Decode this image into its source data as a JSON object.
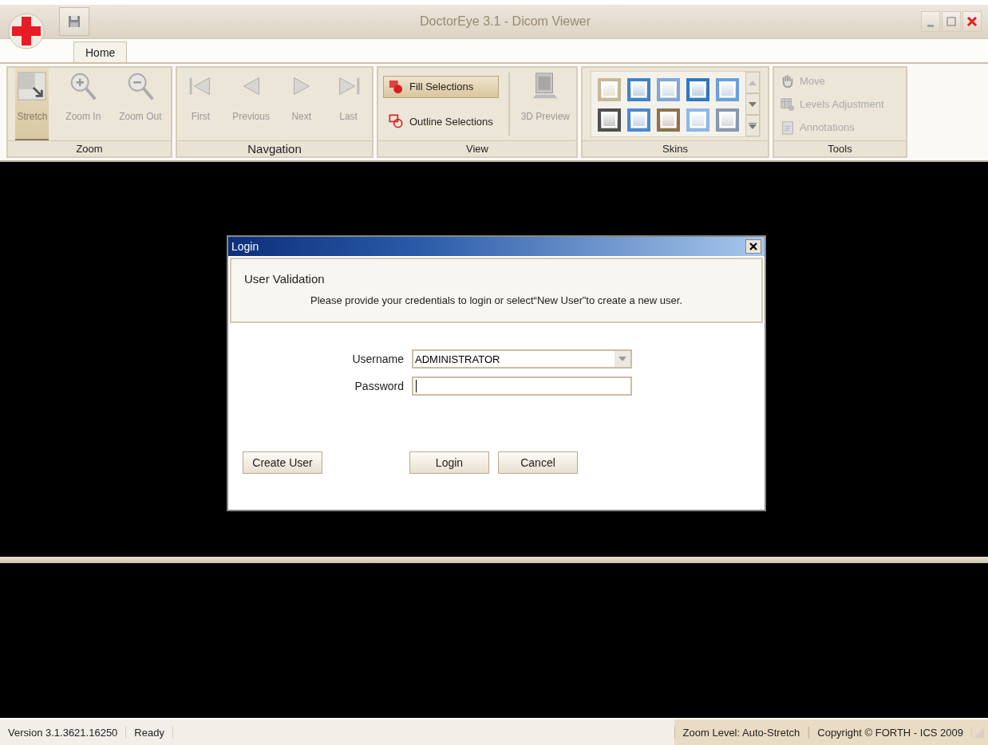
{
  "window": {
    "title": "DoctorEye 3.1 - Dicom Viewer"
  },
  "tabs": [
    {
      "label": "Home",
      "selected": true
    }
  ],
  "ribbon": {
    "groups": [
      {
        "label": "Zoom",
        "kind": "large",
        "items": [
          {
            "label": "Stretch",
            "selected": true,
            "disabled": true
          },
          {
            "label": "Zoom In",
            "selected": false,
            "disabled": true
          },
          {
            "label": "Zoom Out",
            "selected": false,
            "disabled": true
          }
        ]
      },
      {
        "label": "Navgation",
        "kind": "large",
        "items": [
          {
            "label": "First",
            "selected": false,
            "disabled": true
          },
          {
            "label": "Previous",
            "selected": false,
            "disabled": true
          },
          {
            "label": "Next",
            "selected": false,
            "disabled": true
          },
          {
            "label": "Last",
            "selected": false,
            "disabled": true
          }
        ]
      },
      {
        "label": "View",
        "kind": "view",
        "items": [
          {
            "label": "Fill Selections",
            "kind": "toggle",
            "selected": true,
            "disabled": false
          },
          {
            "label": "Outline Selections",
            "kind": "toggle",
            "selected": false,
            "disabled": false
          },
          {
            "label": "3D Preview",
            "kind": "large",
            "selected": false,
            "disabled": true
          }
        ]
      },
      {
        "label": "Skins",
        "kind": "skins",
        "items": [
          {
            "color": "#c8b89a"
          },
          {
            "color": "#3f82c8"
          },
          {
            "color": "#7fa8d8"
          },
          {
            "color": "#2f78c0"
          },
          {
            "color": "#6aa0d8"
          },
          {
            "color": "#505050"
          },
          {
            "color": "#4a8ad0"
          },
          {
            "color": "#8a7450"
          },
          {
            "color": "#8cb8e8"
          },
          {
            "color": "#8898b0"
          }
        ]
      },
      {
        "label": "Tools",
        "kind": "small",
        "items": [
          {
            "label": "Move",
            "disabled": true
          },
          {
            "label": "Levels Adjustment",
            "disabled": true
          },
          {
            "label": "Annotations",
            "disabled": true
          }
        ]
      }
    ]
  },
  "dialog": {
    "title": "Login",
    "heading": "User Validation",
    "description": "Please provide your credentials to login or select“New User”to create a new user.",
    "fields": [
      {
        "label": "Username",
        "kind": "dropdown",
        "value": "ADMINISTRATOR"
      },
      {
        "label": "Password",
        "kind": "password",
        "focused": true
      }
    ],
    "buttons": [
      {
        "label": "Create User",
        "kind": "left"
      },
      {
        "label": "Login",
        "kind": "right"
      },
      {
        "label": "Cancel",
        "kind": "right"
      }
    ]
  },
  "status_bar": {
    "left": [
      "Version 3.1.3621.16250",
      "Ready"
    ],
    "right": [
      "Zoom Level: Auto-Stretch",
      "Copyright © FORTH - ICS 2009"
    ]
  }
}
